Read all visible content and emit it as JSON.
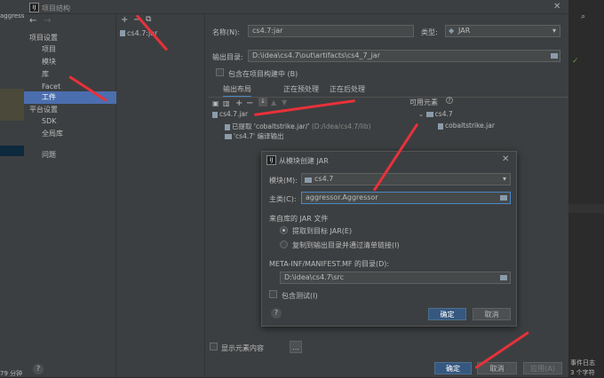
{
  "ide": {
    "left_top_text": "aggressor",
    "left_bottom_text": "79 分钟",
    "right_bottom_1": "事件日志",
    "right_bottom_2": "3 个字符"
  },
  "dialog": {
    "title": "项目结构",
    "help": "?",
    "nav": {
      "section_project": "项目设置",
      "items": [
        "项目",
        "模块",
        "库",
        "Facet",
        "工件"
      ],
      "section_platform": "平台设置",
      "platform_items": [
        "SDK",
        "全局库"
      ],
      "problems": "问题"
    },
    "list": {
      "add": "+",
      "remove": "−",
      "copy": "⧉",
      "artifact": "cs4.7:jar"
    },
    "form": {
      "name_label": "名称(N):",
      "name_value": "cs4.7:jar",
      "type_label": "类型:",
      "type_value": "JAR",
      "output_label": "输出目录:",
      "output_value": "D:\\idea\\cs4.7\\out\\artifacts\\cs4_7_jar",
      "include_build": "包含在项目构建中 (B)"
    },
    "tabs": [
      "输出布局",
      "正在预处理",
      "正在后处理"
    ],
    "layout": {
      "root": "cs4.7.jar",
      "extracted": "已提取 'cobaltstrike.jar/'",
      "extracted_path": "(D:/idea/cs4.7/lib)",
      "compile_output": "'cs4.7' 编译输出"
    },
    "available": {
      "title": "可用元素",
      "module": "cs4.7",
      "jar": "cobaltstrike.jar"
    },
    "show_content": "显示元素内容",
    "more": "...",
    "buttons": {
      "ok": "确定",
      "cancel": "取消",
      "apply": "应用(A)"
    }
  },
  "modal": {
    "title": "从模块创建 JAR",
    "module_label": "模块(M):",
    "module_value": "cs4.7",
    "main_class_label": "主类(C):",
    "main_class_value": "aggressor.Aggressor",
    "lib_section": "来自库的 JAR 文件",
    "radio_extract": "提取到目标 JAR(E)",
    "radio_copy": "复制到输出目录并通过清单链接(I)",
    "manifest_label": "META-INF/MANIFEST.MF 的目录(D):",
    "manifest_value": "D:\\idea\\cs4.7\\src",
    "include_tests": "包含测试(I)",
    "help": "?",
    "ok": "确定",
    "cancel": "取消"
  },
  "colors": {
    "accent": "#4b6eaf",
    "primary_button": "#365880",
    "annotation_arrow": "#e8313a"
  }
}
